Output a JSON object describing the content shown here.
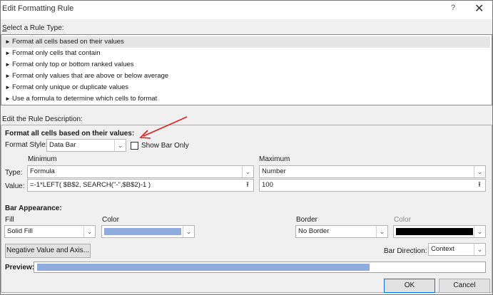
{
  "window": {
    "title": "Edit Formatting Rule",
    "help_glyph": "?",
    "close_glyph": "✕"
  },
  "rule_type": {
    "label": "Select a Rule Type:",
    "items": [
      "Format all cells based on their values",
      "Format only cells that contain",
      "Format only top or bottom ranked values",
      "Format only values that are above or below average",
      "Format only unique or duplicate values",
      "Use a formula to determine which cells to format"
    ],
    "selected_index": 0,
    "arrow_glyph": "►"
  },
  "description": {
    "label": "Edit the Rule Description:",
    "heading": "Format all cells based on their values:",
    "format_style_label": "Format Style:",
    "format_style_value": "Data Bar",
    "show_bar_only_label": "Show Bar Only",
    "show_bar_only_checked": false,
    "minimum_label": "Minimum",
    "maximum_label": "Maximum",
    "type_label": "Type:",
    "value_label": "Value:",
    "min_type": "Formula",
    "min_value": "=-1*LEFT( $B$2, SEARCH(\"-\",$B$2)-1 )",
    "max_type": "Number",
    "max_value": "100"
  },
  "bar_appearance": {
    "heading": "Bar Appearance:",
    "fill_label": "Fill",
    "color_label": "Color",
    "border_label": "Border",
    "border_color_label": "Color",
    "fill_value": "Solid Fill",
    "fill_color": "#8faadc",
    "border_value": "No Border",
    "border_color": "#000000",
    "negative_button": "Negative Value and Axis...",
    "bar_direction_label": "Bar Direction:",
    "bar_direction_value": "Context",
    "preview_label": "Preview:",
    "preview_fraction": 0.74
  },
  "buttons": {
    "ok": "OK",
    "cancel": "Cancel"
  },
  "annotation": {
    "arrow_color": "#e02020"
  },
  "icons": {
    "dropdown": "chevron-down-icon",
    "collapse": "collapse-dialog-icon"
  }
}
